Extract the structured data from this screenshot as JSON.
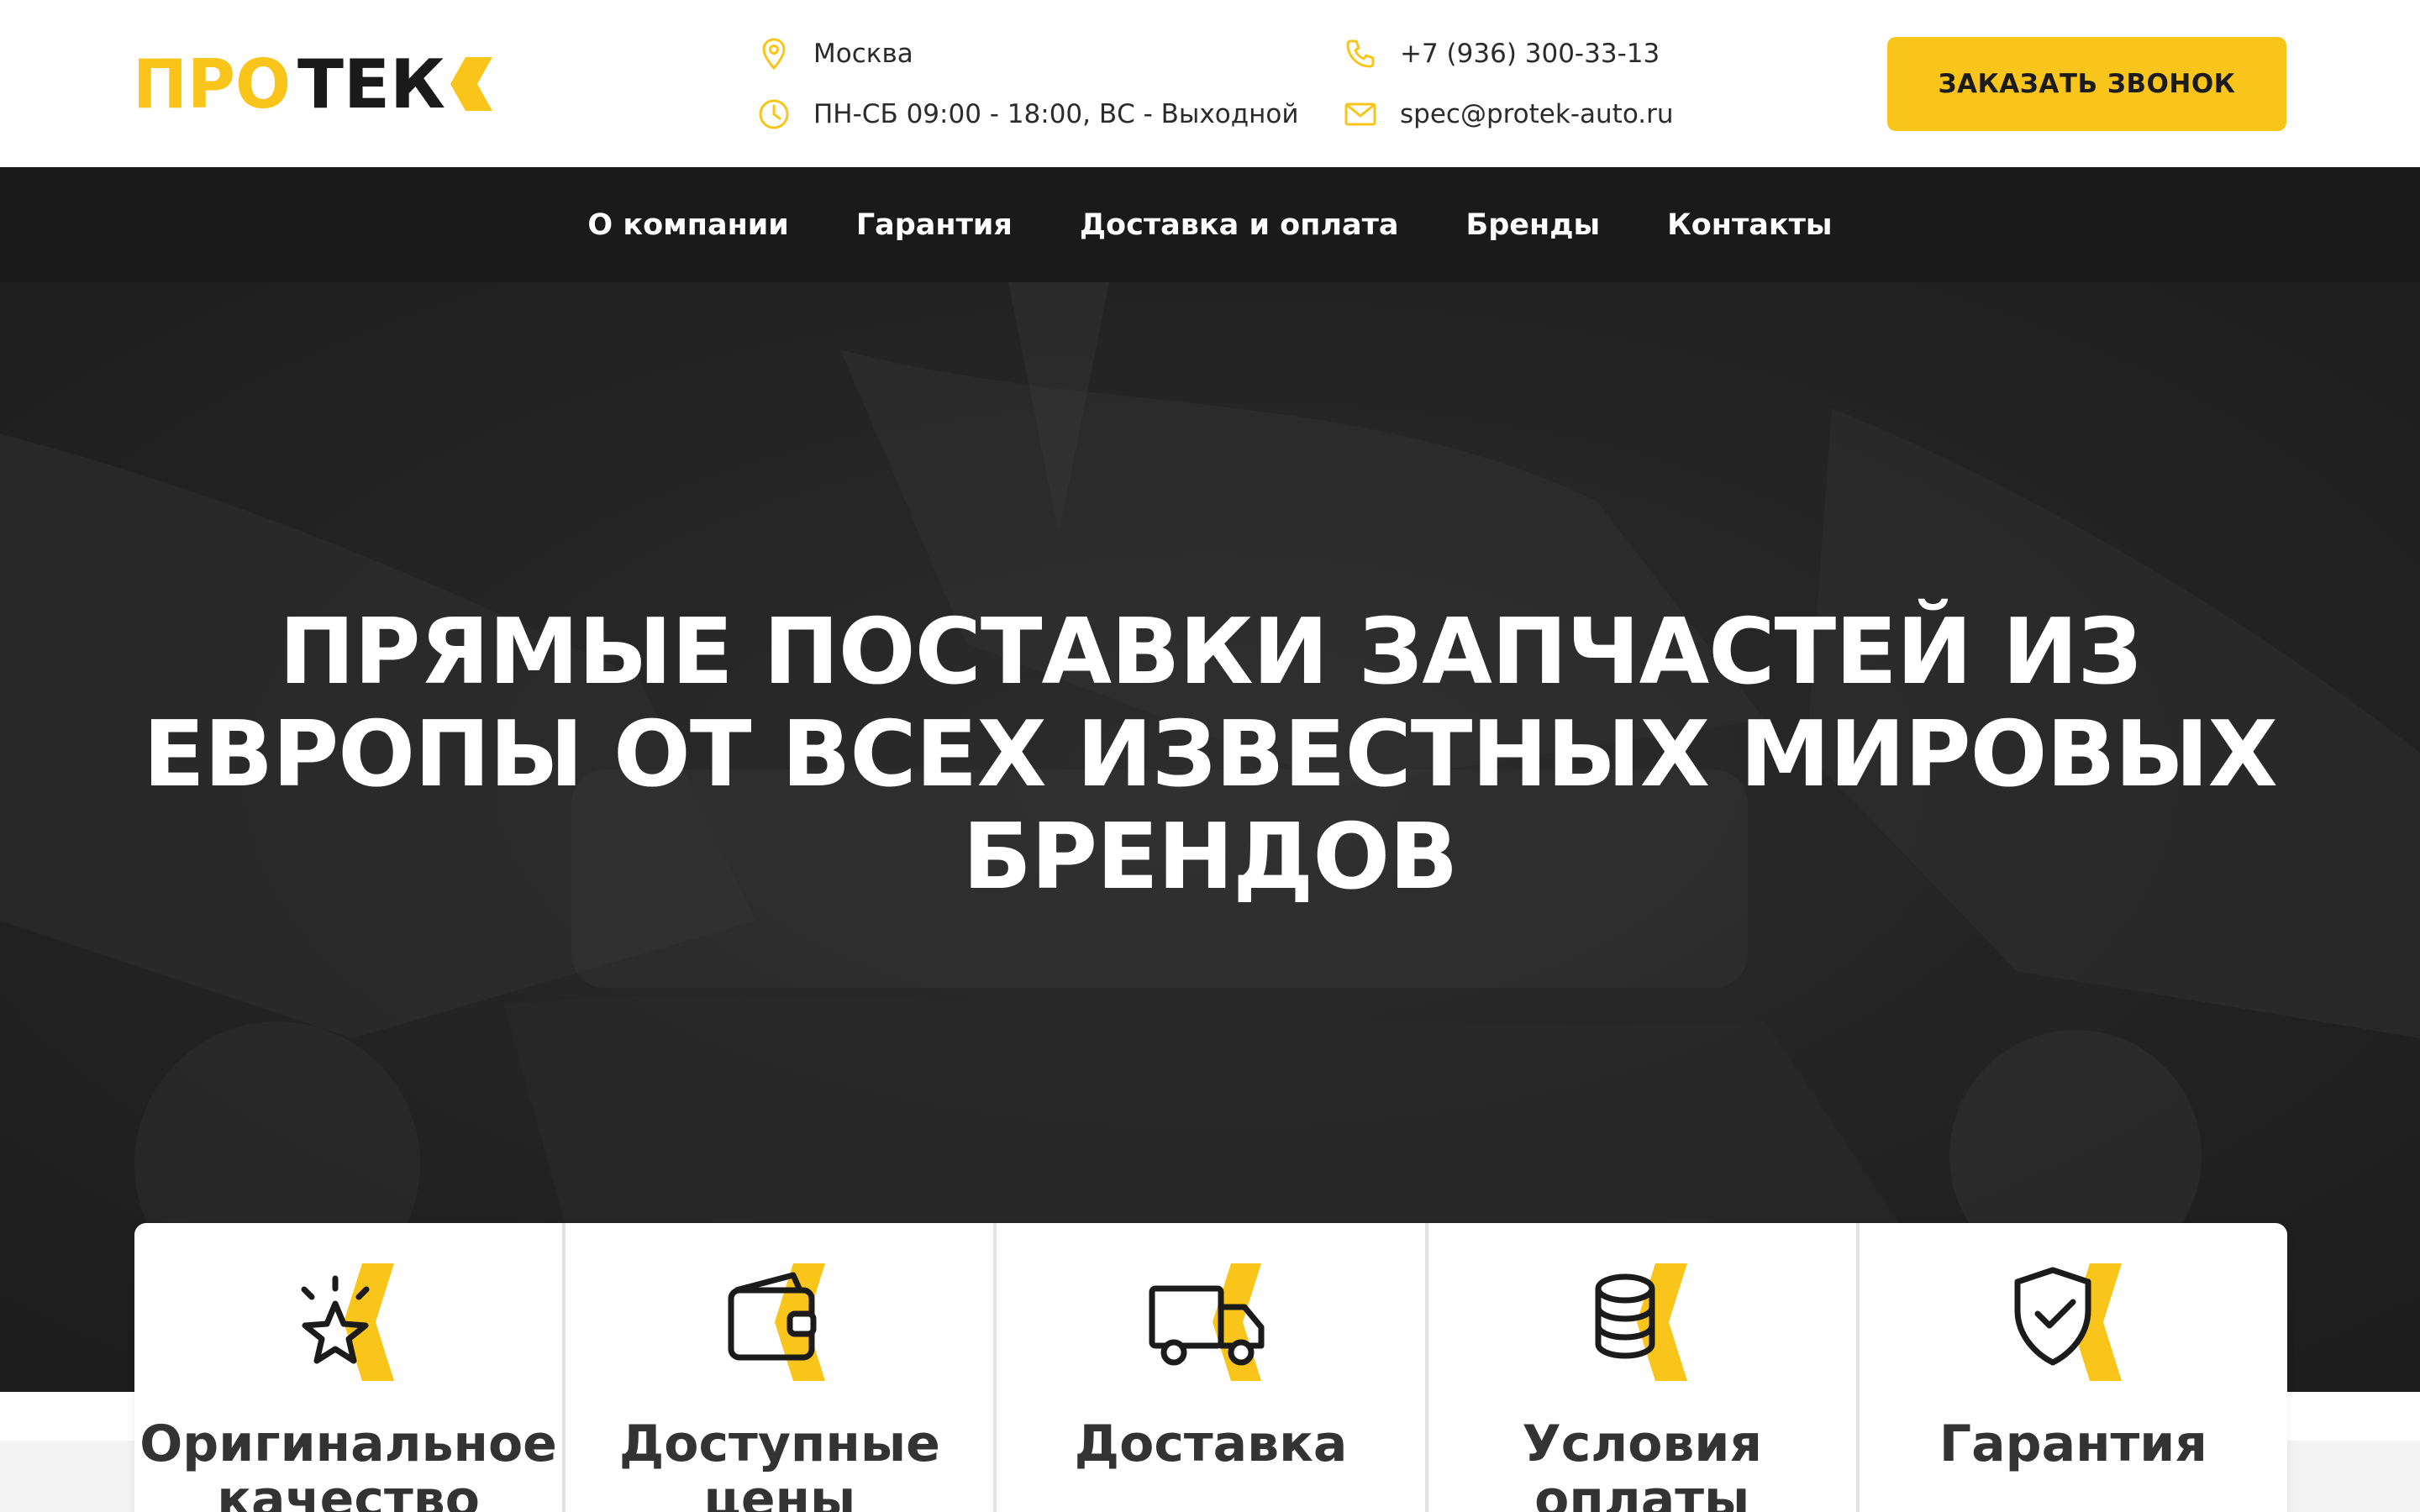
{
  "brand": {
    "logo_text_part1": "ПРО",
    "logo_text_part2": "ТЕК",
    "accent_color": "#f9c51a",
    "dark_color": "#1a1a1a"
  },
  "header": {
    "city": "Москва",
    "hours": "ПН-СБ 09:00 - 18:00, ВС - Выходной",
    "phone": "+7 (936) 300-33-13",
    "email": "spec@protek-auto.ru",
    "call_button": "ЗАКАЗАТЬ ЗВОНОК",
    "icons": [
      "location-pin-icon",
      "clock-icon",
      "phone-icon",
      "mail-icon"
    ]
  },
  "nav": {
    "items": [
      {
        "label": "О компании"
      },
      {
        "label": "Гарантия"
      },
      {
        "label": "Доставка и оплата"
      },
      {
        "label": "Бренды"
      },
      {
        "label": "Контакты"
      }
    ]
  },
  "hero": {
    "title": "ПРЯМЫЕ ПОСТАВКИ ЗАПЧАСТЕЙ ИЗ ЕВРОПЫ ОТ ВСЕХ ИЗВЕСТНЫХ МИРОВЫХ БРЕНДОВ"
  },
  "features": [
    {
      "label": "Оригинальное качество",
      "icon": "star-icon"
    },
    {
      "label": "Доступные цены",
      "icon": "wallet-icon"
    },
    {
      "label": "Доставка",
      "icon": "truck-icon"
    },
    {
      "label": "Условия оплаты",
      "icon": "coins-icon"
    },
    {
      "label": "Гарантия",
      "icon": "shield-check-icon"
    }
  ]
}
